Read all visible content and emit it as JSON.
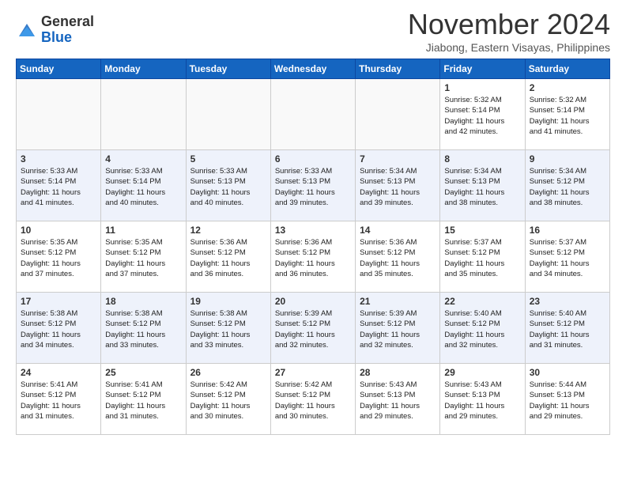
{
  "header": {
    "logo_general": "General",
    "logo_blue": "Blue",
    "month_year": "November 2024",
    "location": "Jiabong, Eastern Visayas, Philippines"
  },
  "weekdays": [
    "Sunday",
    "Monday",
    "Tuesday",
    "Wednesday",
    "Thursday",
    "Friday",
    "Saturday"
  ],
  "weeks": [
    [
      {
        "day": "",
        "info": ""
      },
      {
        "day": "",
        "info": ""
      },
      {
        "day": "",
        "info": ""
      },
      {
        "day": "",
        "info": ""
      },
      {
        "day": "",
        "info": ""
      },
      {
        "day": "1",
        "info": "Sunrise: 5:32 AM\nSunset: 5:14 PM\nDaylight: 11 hours\nand 42 minutes."
      },
      {
        "day": "2",
        "info": "Sunrise: 5:32 AM\nSunset: 5:14 PM\nDaylight: 11 hours\nand 41 minutes."
      }
    ],
    [
      {
        "day": "3",
        "info": "Sunrise: 5:33 AM\nSunset: 5:14 PM\nDaylight: 11 hours\nand 41 minutes."
      },
      {
        "day": "4",
        "info": "Sunrise: 5:33 AM\nSunset: 5:14 PM\nDaylight: 11 hours\nand 40 minutes."
      },
      {
        "day": "5",
        "info": "Sunrise: 5:33 AM\nSunset: 5:13 PM\nDaylight: 11 hours\nand 40 minutes."
      },
      {
        "day": "6",
        "info": "Sunrise: 5:33 AM\nSunset: 5:13 PM\nDaylight: 11 hours\nand 39 minutes."
      },
      {
        "day": "7",
        "info": "Sunrise: 5:34 AM\nSunset: 5:13 PM\nDaylight: 11 hours\nand 39 minutes."
      },
      {
        "day": "8",
        "info": "Sunrise: 5:34 AM\nSunset: 5:13 PM\nDaylight: 11 hours\nand 38 minutes."
      },
      {
        "day": "9",
        "info": "Sunrise: 5:34 AM\nSunset: 5:12 PM\nDaylight: 11 hours\nand 38 minutes."
      }
    ],
    [
      {
        "day": "10",
        "info": "Sunrise: 5:35 AM\nSunset: 5:12 PM\nDaylight: 11 hours\nand 37 minutes."
      },
      {
        "day": "11",
        "info": "Sunrise: 5:35 AM\nSunset: 5:12 PM\nDaylight: 11 hours\nand 37 minutes."
      },
      {
        "day": "12",
        "info": "Sunrise: 5:36 AM\nSunset: 5:12 PM\nDaylight: 11 hours\nand 36 minutes."
      },
      {
        "day": "13",
        "info": "Sunrise: 5:36 AM\nSunset: 5:12 PM\nDaylight: 11 hours\nand 36 minutes."
      },
      {
        "day": "14",
        "info": "Sunrise: 5:36 AM\nSunset: 5:12 PM\nDaylight: 11 hours\nand 35 minutes."
      },
      {
        "day": "15",
        "info": "Sunrise: 5:37 AM\nSunset: 5:12 PM\nDaylight: 11 hours\nand 35 minutes."
      },
      {
        "day": "16",
        "info": "Sunrise: 5:37 AM\nSunset: 5:12 PM\nDaylight: 11 hours\nand 34 minutes."
      }
    ],
    [
      {
        "day": "17",
        "info": "Sunrise: 5:38 AM\nSunset: 5:12 PM\nDaylight: 11 hours\nand 34 minutes."
      },
      {
        "day": "18",
        "info": "Sunrise: 5:38 AM\nSunset: 5:12 PM\nDaylight: 11 hours\nand 33 minutes."
      },
      {
        "day": "19",
        "info": "Sunrise: 5:38 AM\nSunset: 5:12 PM\nDaylight: 11 hours\nand 33 minutes."
      },
      {
        "day": "20",
        "info": "Sunrise: 5:39 AM\nSunset: 5:12 PM\nDaylight: 11 hours\nand 32 minutes."
      },
      {
        "day": "21",
        "info": "Sunrise: 5:39 AM\nSunset: 5:12 PM\nDaylight: 11 hours\nand 32 minutes."
      },
      {
        "day": "22",
        "info": "Sunrise: 5:40 AM\nSunset: 5:12 PM\nDaylight: 11 hours\nand 32 minutes."
      },
      {
        "day": "23",
        "info": "Sunrise: 5:40 AM\nSunset: 5:12 PM\nDaylight: 11 hours\nand 31 minutes."
      }
    ],
    [
      {
        "day": "24",
        "info": "Sunrise: 5:41 AM\nSunset: 5:12 PM\nDaylight: 11 hours\nand 31 minutes."
      },
      {
        "day": "25",
        "info": "Sunrise: 5:41 AM\nSunset: 5:12 PM\nDaylight: 11 hours\nand 31 minutes."
      },
      {
        "day": "26",
        "info": "Sunrise: 5:42 AM\nSunset: 5:12 PM\nDaylight: 11 hours\nand 30 minutes."
      },
      {
        "day": "27",
        "info": "Sunrise: 5:42 AM\nSunset: 5:12 PM\nDaylight: 11 hours\nand 30 minutes."
      },
      {
        "day": "28",
        "info": "Sunrise: 5:43 AM\nSunset: 5:13 PM\nDaylight: 11 hours\nand 29 minutes."
      },
      {
        "day": "29",
        "info": "Sunrise: 5:43 AM\nSunset: 5:13 PM\nDaylight: 11 hours\nand 29 minutes."
      },
      {
        "day": "30",
        "info": "Sunrise: 5:44 AM\nSunset: 5:13 PM\nDaylight: 11 hours\nand 29 minutes."
      }
    ]
  ]
}
